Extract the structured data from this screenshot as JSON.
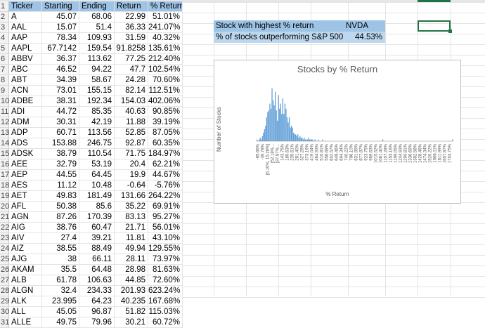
{
  "table": {
    "headers": [
      "Ticker",
      "Starting",
      "Ending",
      "Return",
      "% Return"
    ],
    "rows": [
      [
        "A",
        "45.07",
        "68.06",
        "22.99",
        "51.01%"
      ],
      [
        "AAL",
        "15.07",
        "51.4",
        "36.33",
        "241.07%"
      ],
      [
        "AAP",
        "78.34",
        "109.93",
        "31.59",
        "40.32%"
      ],
      [
        "AAPL",
        "67.7142",
        "159.54",
        "91.8258",
        "135.61%"
      ],
      [
        "ABBV",
        "36.37",
        "113.62",
        "77.25",
        "212.40%"
      ],
      [
        "ABC",
        "46.52",
        "94.22",
        "47.7",
        "102.54%"
      ],
      [
        "ABT",
        "34.39",
        "58.67",
        "24.28",
        "70.60%"
      ],
      [
        "ACN",
        "73.01",
        "155.15",
        "82.14",
        "112.51%"
      ],
      [
        "ADBE",
        "38.31",
        "192.34",
        "154.03",
        "402.06%"
      ],
      [
        "ADI",
        "44.72",
        "85.35",
        "40.63",
        "90.85%"
      ],
      [
        "ADM",
        "30.31",
        "42.19",
        "11.88",
        "39.19%"
      ],
      [
        "ADP",
        "60.71",
        "113.56",
        "52.85",
        "87.05%"
      ],
      [
        "ADS",
        "153.88",
        "246.75",
        "92.87",
        "60.35%"
      ],
      [
        "ADSK",
        "38.79",
        "110.54",
        "71.75",
        "184.97%"
      ],
      [
        "AEE",
        "32.79",
        "53.19",
        "20.4",
        "62.21%"
      ],
      [
        "AEP",
        "44.55",
        "64.45",
        "19.9",
        "44.67%"
      ],
      [
        "AES",
        "11.12",
        "10.48",
        "-0.64",
        "-5.76%"
      ],
      [
        "AET",
        "49.83",
        "181.49",
        "131.66",
        "264.22%"
      ],
      [
        "AFL",
        "50.38",
        "85.6",
        "35.22",
        "69.91%"
      ],
      [
        "AGN",
        "87.26",
        "170.39",
        "83.13",
        "95.27%"
      ],
      [
        "AIG",
        "38.76",
        "60.47",
        "21.71",
        "56.01%"
      ],
      [
        "AIV",
        "27.4",
        "39.21",
        "11.81",
        "43.10%"
      ],
      [
        "AIZ",
        "38.55",
        "88.49",
        "49.94",
        "129.55%"
      ],
      [
        "AJG",
        "38",
        "66.11",
        "28.11",
        "73.97%"
      ],
      [
        "AKAM",
        "35.5",
        "64.48",
        "28.98",
        "81.63%"
      ],
      [
        "ALB",
        "61.78",
        "106.63",
        "44.85",
        "72.60%"
      ],
      [
        "ALGN",
        "32.4",
        "234.33",
        "201.93",
        "623.24%"
      ],
      [
        "ALK",
        "23.995",
        "64.23",
        "40.235",
        "167.68%"
      ],
      [
        "ALL",
        "45.05",
        "96.87",
        "51.82",
        "115.03%"
      ],
      [
        "ALLE",
        "49.75",
        "79.96",
        "30.21",
        "60.72%"
      ]
    ],
    "row_numbers": [
      "1",
      "2",
      "3",
      "4",
      "5",
      "6",
      "7",
      "8",
      "9",
      "10",
      "11",
      "12",
      "13",
      "14",
      "15",
      "16",
      "17",
      "18",
      "19",
      "20",
      "21",
      "22",
      "23",
      "24",
      "25",
      "26",
      "27",
      "28",
      "29",
      "30",
      "31"
    ]
  },
  "summary": {
    "highest_label": "Stock with highest % return",
    "highest_value": "NVDA",
    "outperform_label": "% of stocks outperforming S&P 500",
    "outperform_value": "44.53%"
  },
  "colors": {
    "header_fill": "#9dc3e6",
    "info_fill": "#bdd7ee",
    "bar_color": "#5b9bd5",
    "selection": "#217346"
  },
  "chart_data": {
    "type": "bar",
    "title": "Stocks by % Return",
    "xlabel": "% Return",
    "ylabel": "Number of Stocks",
    "ylim": [
      0,
      35
    ],
    "bins": [
      "-85.66%",
      "-39.78%",
      "[6.10%, 15.28%]",
      "[52.18%...",
      "[97.87%...",
      "143.75%",
      "189.63%",
      "235.51%",
      "281.40%",
      "327.28%",
      "373.16%",
      "419.04%",
      "464.93%",
      "510.81%",
      "556.69%",
      "602.57%",
      "648.46%",
      "694.34%",
      "740.22%",
      "786.10%",
      "831.99%",
      "877.87%",
      "923.75%",
      "969.63%",
      "1015.52%",
      "1061.40%",
      "1107.28%",
      "1153.16%",
      "1199.05%",
      "1244.93%",
      "1290.81%",
      "1336.69%",
      "1382.58%",
      "1428.46%",
      "1474.34%",
      "1520.22%",
      "1566.11%",
      "1611.99%",
      "1657.87%",
      "1703.75%"
    ],
    "values": [
      1,
      0,
      1,
      2,
      1,
      3,
      5,
      7,
      9,
      14,
      17,
      18,
      22,
      19,
      31,
      24,
      21,
      29,
      18,
      12,
      27,
      19,
      22,
      16,
      25,
      16,
      22,
      19,
      14,
      11,
      14,
      8,
      9,
      8,
      5,
      4,
      4,
      3,
      4,
      2,
      3,
      2,
      2,
      1,
      2,
      1,
      1,
      1,
      2,
      1,
      1,
      1,
      1,
      0,
      1,
      0,
      0,
      1,
      0,
      0,
      0,
      1,
      0,
      0,
      0,
      0,
      0,
      0,
      0,
      0,
      0,
      0,
      0,
      0,
      0,
      0,
      0,
      0,
      0,
      0,
      0,
      0,
      0,
      0,
      0,
      0,
      0,
      0,
      0,
      0,
      0,
      0,
      0,
      0,
      0,
      0,
      0,
      0,
      0,
      0,
      0,
      0,
      0,
      0,
      0,
      0,
      0,
      0,
      0,
      0,
      0,
      0,
      0,
      0,
      0,
      0,
      0,
      1,
      0,
      0,
      0,
      0,
      0,
      0,
      0,
      0,
      0,
      0,
      0,
      0,
      0,
      0,
      0,
      0,
      0,
      0,
      0,
      0,
      0,
      0,
      0,
      0,
      0,
      0,
      0,
      0,
      0,
      0,
      0,
      0,
      0,
      0,
      0,
      0,
      0,
      0,
      0,
      0,
      0,
      0,
      0,
      0,
      0,
      0,
      0,
      0,
      0,
      0,
      0,
      0,
      0,
      0,
      0,
      0,
      0,
      0,
      0,
      0,
      0,
      0,
      0,
      0,
      1
    ],
    "grid": false,
    "legend": "none"
  }
}
